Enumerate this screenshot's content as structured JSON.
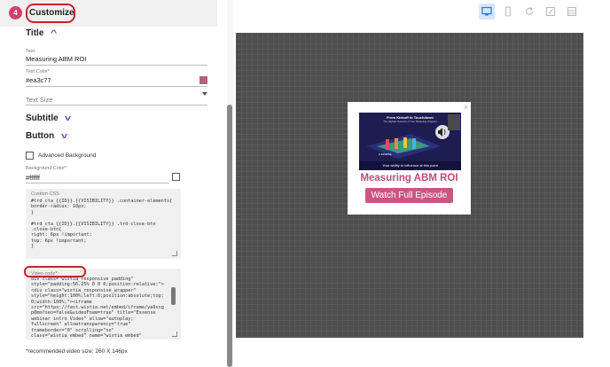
{
  "step": {
    "number": "4",
    "title": "Customize"
  },
  "sections": {
    "title": "Title",
    "subtitle": "Subtitle",
    "button": "Button"
  },
  "fields": {
    "text_label": "Text",
    "text_value": "Measuring ABM ROI",
    "text_color_label": "Text Color*",
    "text_color_value": "#ea3c77",
    "text_size_placeholder": "Text Size",
    "advanced_background_label": "Advanced Background",
    "background_color_label": "Background Color*",
    "background_color_value": "#ffffff",
    "custom_css_label": "Custom CSS",
    "custom_css_value": "#trd_cta_{{ID}}.{{VISIBILITY}} .container-elements{\nborder-radius: 10px;\n}\n\n#trd_cta_{{ID}}.{{VISIBILITY}} .trd-close-btn\n.close-btn{\nright: 6px !important;\ntop: 6px !important;\n}",
    "video_code_label": "Video code*",
    "video_code_value": "div class=\"wistia_responsive_padding\"\nstyle=\"padding:56.25% 0 0 0;position:relative;\">\n<div class=\"wistia_responsive_wrapper\"\nstyle=\"height:100%;left:0;position:absolute;top:\n0;width:100%;\"><iframe\nsrc=\"https://fast.wistia.net/embed/iframe/ya9vsg\np0mm?seo=false&videoFoam=true\" title=\"Essense\nwebinar intro Video\" allow=\"autoplay;\nfullscreen\" allowtransparency=\"true\"\nframeborder=\"0\" scrolling=\"no\"\nclass=\"wistia_embed\" name=\"wistia_embed\"",
    "recommended_note": "*recommended video size: 260 X 146px"
  },
  "preview": {
    "video_headline": "From Kickoff to Touchdown",
    "video_subhead": "The Highest Success of Your Marketing Program",
    "video_caption": "Your ability to influence at this point",
    "video_logo": "⊗ ESSENSE",
    "title": "Measuring ABM ROI",
    "button_label": "Watch Full Episode",
    "close_glyph": "×"
  },
  "colors": {
    "accent": "#d4406a",
    "annotation_red": "#c0262e",
    "chevron_purple": "#7b4fc4",
    "text_color_swatch": "#b95f82",
    "popup_title": "#c04a78",
    "popup_button": "#c9577f",
    "toolbar_active": "#2c7be5"
  },
  "toolbar": {
    "icons": [
      "desktop-icon",
      "mobile-icon",
      "refresh-icon",
      "edit-icon",
      "layout-icon"
    ]
  }
}
